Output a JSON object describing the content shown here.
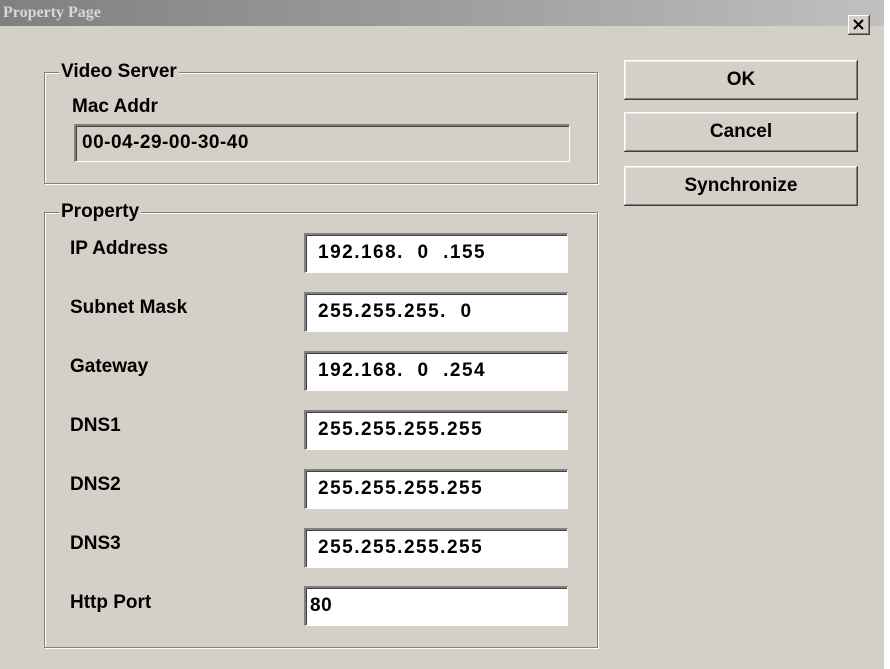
{
  "window": {
    "title": "Property Page",
    "close_icon": "close-icon"
  },
  "video_server": {
    "group_title": "Video Server",
    "mac_label": "Mac Addr",
    "mac_value": "00-04-29-00-30-40"
  },
  "property": {
    "group_title": "Property",
    "fields": [
      {
        "label": "IP Address",
        "value": "192.168.  0  .155"
      },
      {
        "label": "Subnet Mask",
        "value": "255.255.255.  0"
      },
      {
        "label": "Gateway",
        "value": "192.168.  0  .254"
      },
      {
        "label": "DNS1",
        "value": "255.255.255.255"
      },
      {
        "label": "DNS2",
        "value": "255.255.255.255"
      },
      {
        "label": "DNS3",
        "value": "255.255.255.255"
      },
      {
        "label": "Http Port",
        "value": "80"
      }
    ]
  },
  "buttons": {
    "ok": "OK",
    "cancel": "Cancel",
    "synchronize": "Synchronize"
  },
  "colors": {
    "dialog_face": "#d4d0c8",
    "titlebar_inactive": "#808080"
  }
}
